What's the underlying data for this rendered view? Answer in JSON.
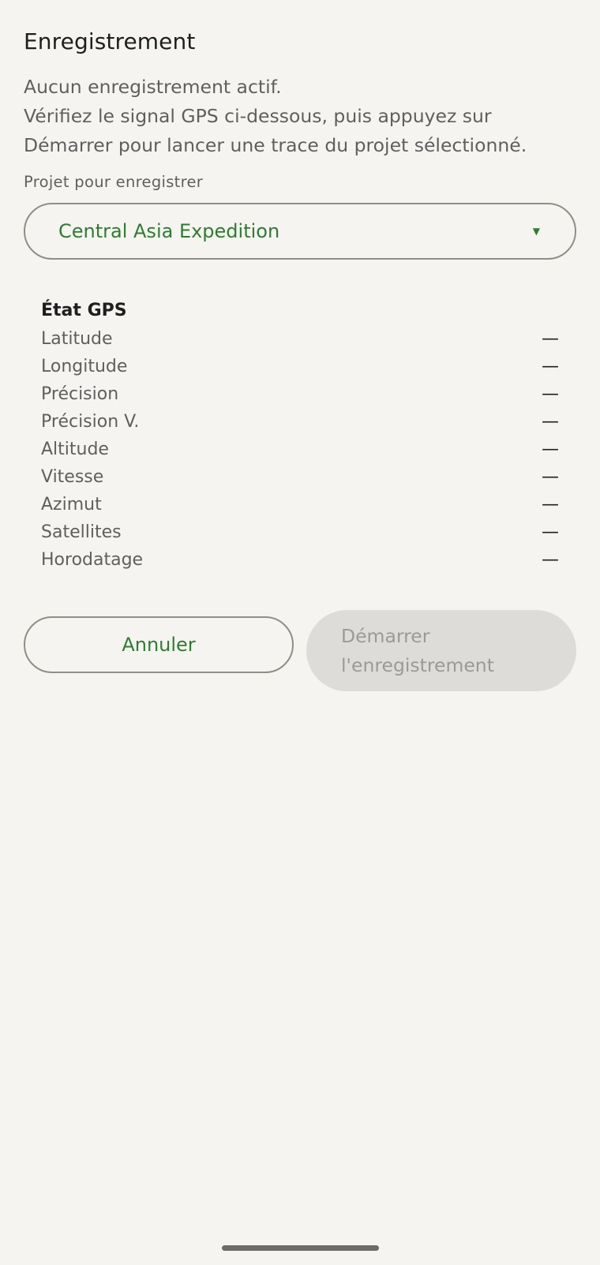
{
  "header": {
    "title": "Enregistrement"
  },
  "description": {
    "line1": "Aucun enregistrement actif.",
    "line2": "Vérifiez le signal GPS ci-dessous, puis appuyez sur",
    "line3": "Démarrer pour lancer une trace du projet sélectionné."
  },
  "project": {
    "label": "Projet pour enregistrer",
    "selected": "Central Asia Expedition",
    "arrow": "▼"
  },
  "gps": {
    "title": "État GPS",
    "rows": [
      {
        "label": "Latitude",
        "value": "—"
      },
      {
        "label": "Longitude",
        "value": "—"
      },
      {
        "label": "Précision",
        "value": "—"
      },
      {
        "label": "Précision V.",
        "value": "—"
      },
      {
        "label": "Altitude",
        "value": "—"
      },
      {
        "label": "Vitesse",
        "value": "—"
      },
      {
        "label": "Azimut",
        "value": "—"
      },
      {
        "label": "Satellites",
        "value": "—"
      },
      {
        "label": "Horodatage",
        "value": "—"
      }
    ]
  },
  "actions": {
    "cancel_label": "Annuler",
    "start_line1": "Démarrer",
    "start_line2": "l'enregistrement"
  },
  "colors": {
    "background": "#f5f4f0",
    "accent": "#2e7d32",
    "outline": "#8f8f88",
    "disabled_bg": "#dddcd9",
    "disabled_text": "#9a9a98"
  }
}
